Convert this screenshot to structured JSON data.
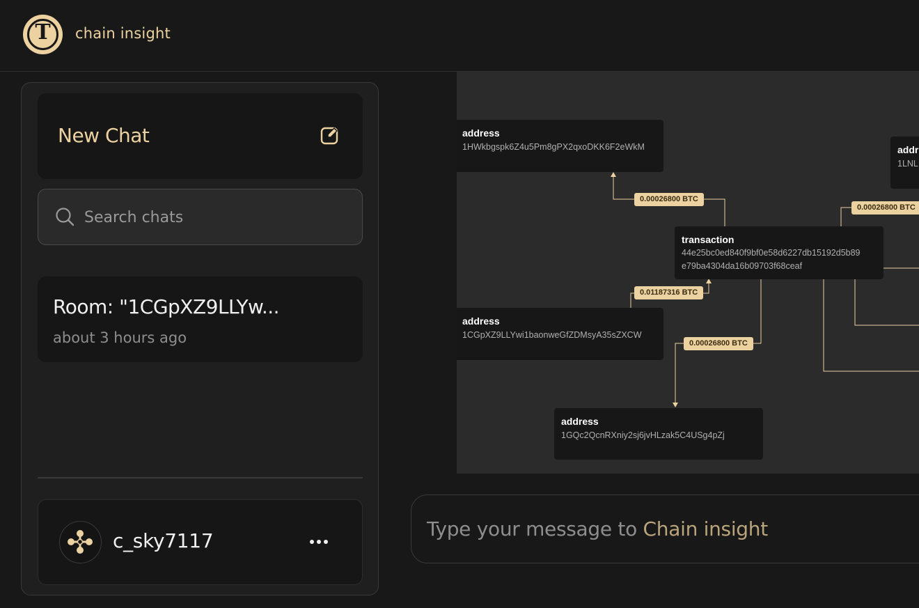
{
  "header": {
    "app_title": "chain insight",
    "logo_glyph": "T"
  },
  "sidebar": {
    "new_chat_label": "New Chat",
    "search_placeholder": "Search chats",
    "rooms": [
      {
        "title": "Room: \"1CGpXZ9LLYw...",
        "time": "about 3 hours ago"
      }
    ],
    "user": {
      "username": "c_sky7117"
    }
  },
  "graph": {
    "nodes": [
      {
        "type": "address",
        "id": "1HWkbgspk6Z4u5Pm8gPX2qxoDKK6F2eWkM"
      },
      {
        "type": "transaction",
        "id_line1": "44e25bc0ed840f9bf0e58d6227db15192d5b89",
        "id_line2": "e79ba4304da16b09703f68ceaf"
      },
      {
        "type": "address",
        "id": "1CGpXZ9LLYwi1baonweGfZDMsyA35sZXCW"
      },
      {
        "type": "address",
        "id": "1GQc2QcnRXniy2sj6jvHLzak5C4USg4pZj"
      },
      {
        "type": "addr",
        "id": "1LNL"
      }
    ],
    "edges": [
      {
        "label": "0.00026800 BTC"
      },
      {
        "label": "0.01187316 BTC"
      },
      {
        "label": "0.00026800 BTC"
      },
      {
        "label": "0.00026800 BTC"
      }
    ]
  },
  "composer": {
    "placeholder_prefix": "Type your message to ",
    "placeholder_brand": "Chain insight"
  },
  "colors": {
    "accent": "#ecd2a0",
    "background": "#181818",
    "panel": "#161616",
    "graph_bg": "#2b2b2b"
  }
}
